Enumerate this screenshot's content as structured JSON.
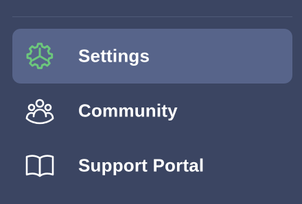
{
  "sidebar": {
    "items": [
      {
        "label": "Settings",
        "icon": "gear-icon",
        "active": true,
        "icon_color": "#6cc77c"
      },
      {
        "label": "Community",
        "icon": "community-icon",
        "active": false,
        "icon_color": "#ffffff"
      },
      {
        "label": "Support Portal",
        "icon": "book-icon",
        "active": false,
        "icon_color": "#ffffff"
      }
    ]
  },
  "colors": {
    "background": "#3b4562",
    "active_item": "#57648a",
    "divider": "#4f5a78",
    "accent": "#6cc77c"
  }
}
